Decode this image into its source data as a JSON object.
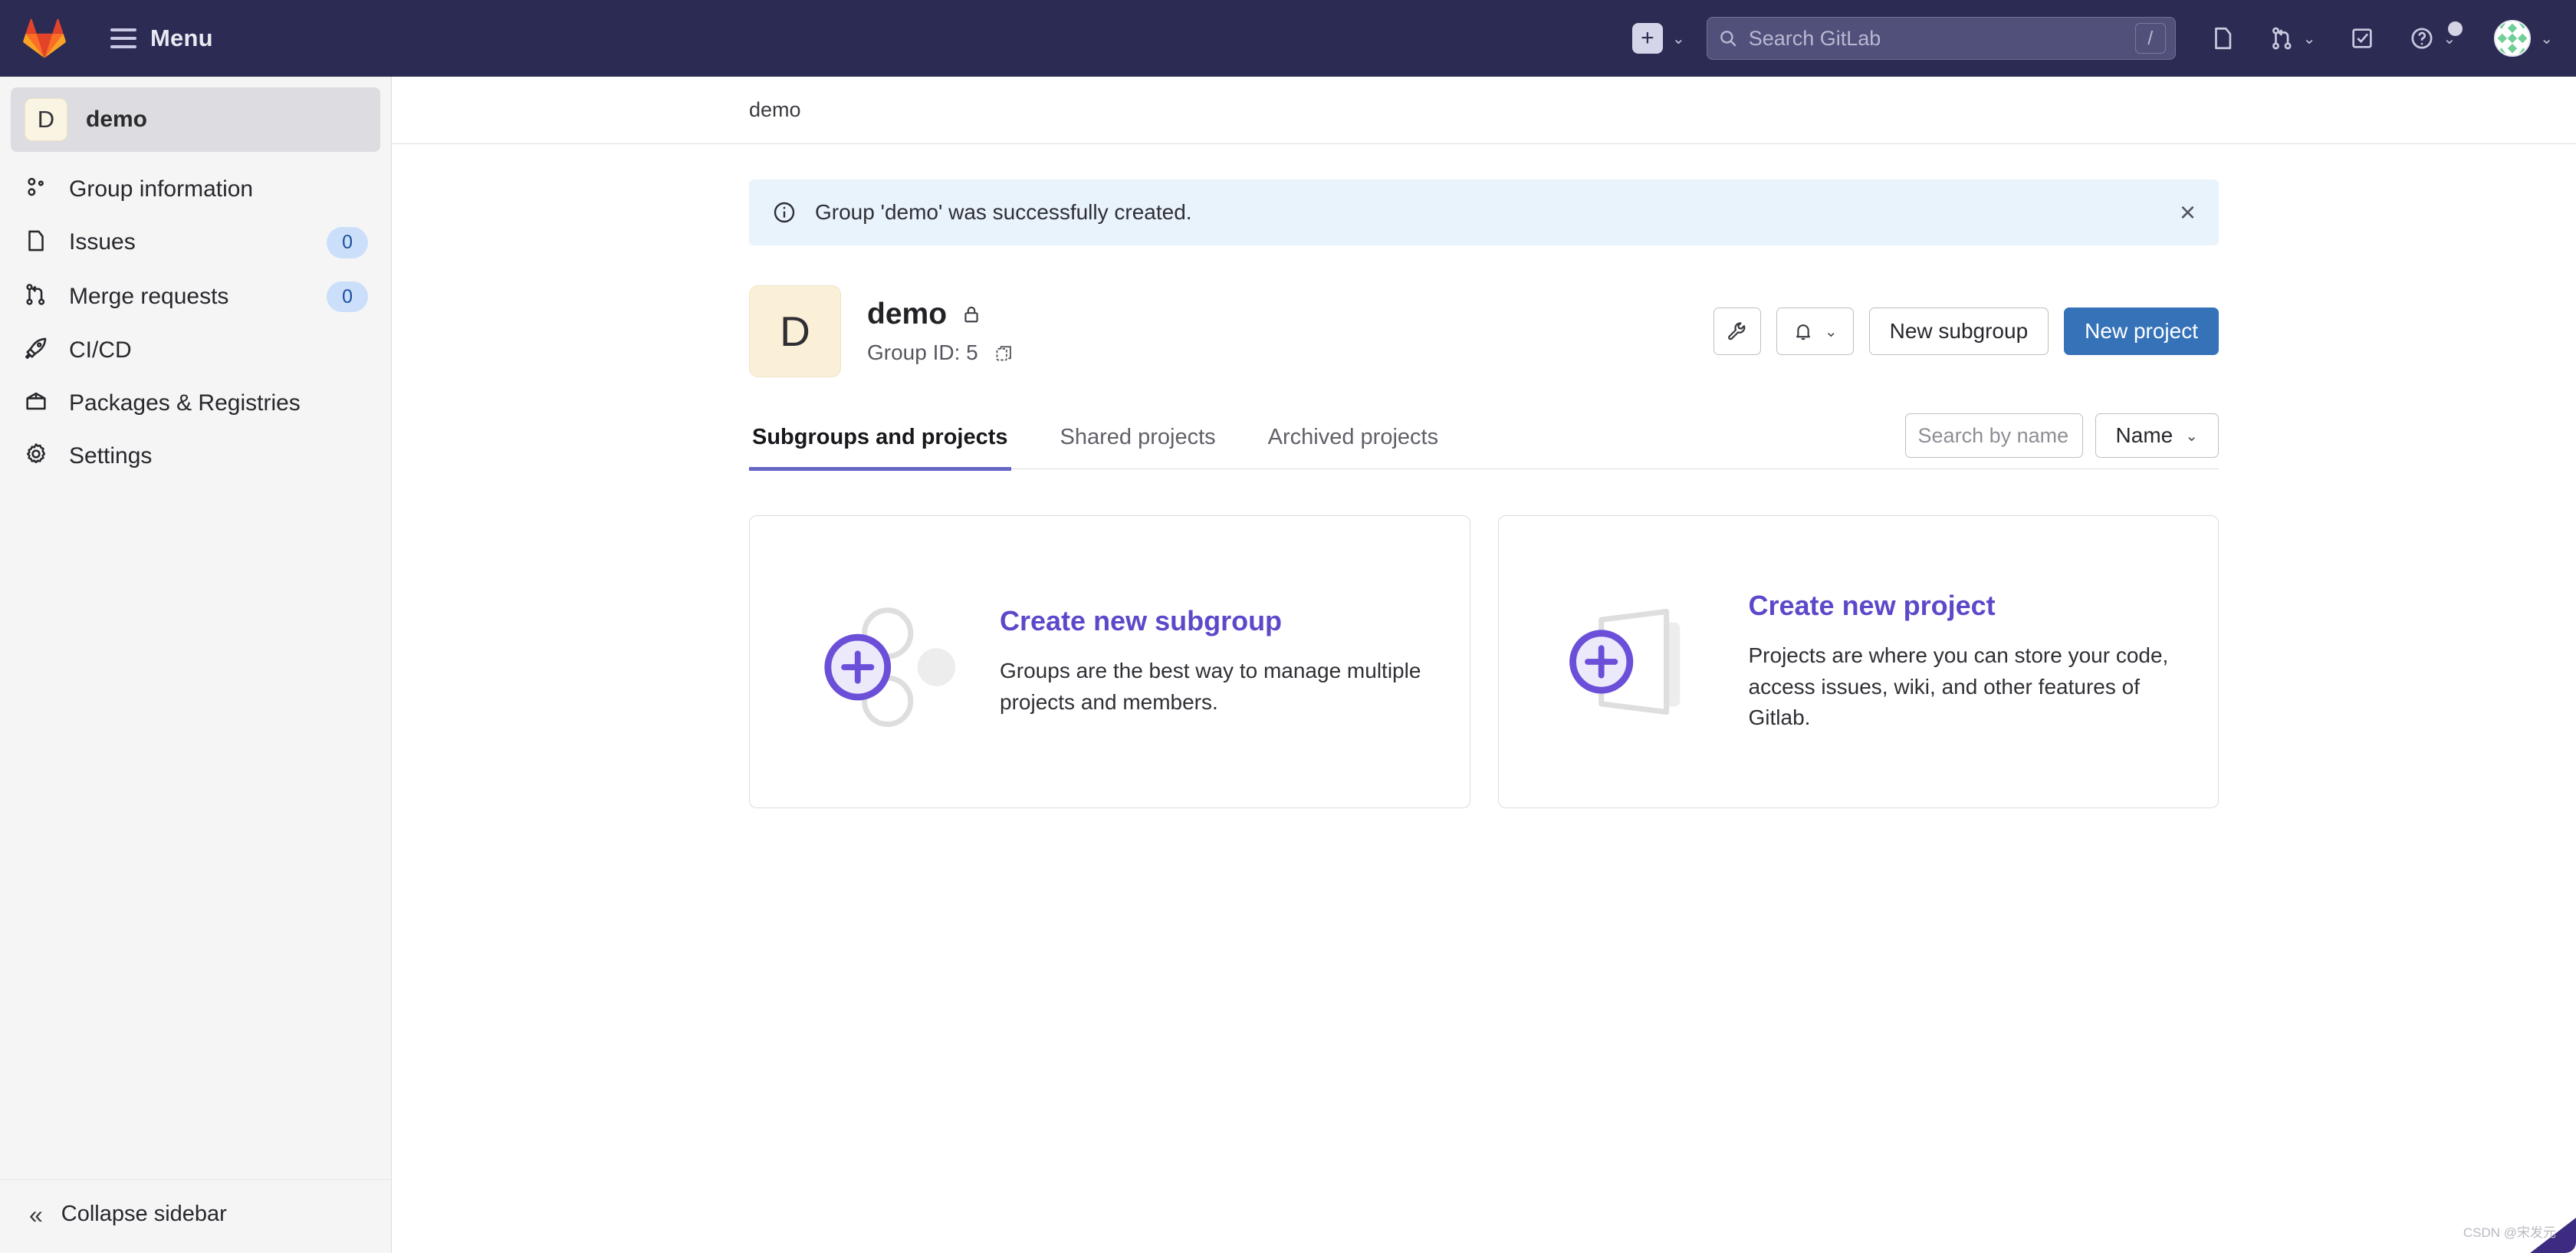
{
  "topnav": {
    "logo_icon": "gitlab-logo-icon",
    "menu_label": "Menu",
    "create_icon": "plus-icon",
    "create_chevron_icon": "chevron-down-icon",
    "search": {
      "icon": "search-icon",
      "placeholder": "Search GitLab",
      "value": "",
      "shortcut": "/"
    },
    "icons": [
      {
        "name": "issues-icon",
        "label": "Issues"
      },
      {
        "name": "merge-requests-icon",
        "label": "Merge requests"
      },
      {
        "name": "todos-icon",
        "label": "To-Do List"
      },
      {
        "name": "help-icon",
        "label": "Help"
      }
    ],
    "avatar_icon": "user-avatar",
    "avatar_chevron_icon": "chevron-down-icon",
    "bg_color": "#2b2b54"
  },
  "sidebar": {
    "group": {
      "initial": "D",
      "name": "demo"
    },
    "items": [
      {
        "label": "Group information",
        "icon": "group-information-icon",
        "badge": null
      },
      {
        "label": "Issues",
        "icon": "issues-icon",
        "badge": "0"
      },
      {
        "label": "Merge requests",
        "icon": "merge-requests-icon",
        "badge": "0"
      },
      {
        "label": "CI/CD",
        "icon": "rocket-icon",
        "badge": null
      },
      {
        "label": "Packages & Registries",
        "icon": "package-icon",
        "badge": null
      },
      {
        "label": "Settings",
        "icon": "gear-icon",
        "badge": null
      }
    ],
    "collapse": {
      "label": "Collapse sidebar",
      "icon": "chevron-double-left-icon"
    }
  },
  "breadcrumb": {
    "items": [
      "demo"
    ]
  },
  "alert": {
    "icon": "information-circle-icon",
    "message": "Group 'demo' was successfully created.",
    "close_icon": "close-icon",
    "bg_color": "#e9f3fc"
  },
  "group_header": {
    "initial": "D",
    "name": "demo",
    "visibility_icon": "lock-icon",
    "group_id_label": "Group ID: 5",
    "copy_icon": "copy-to-clipboard-icon",
    "actions": {
      "settings_icon": "wrench-icon",
      "notifications_icon": "bell-icon",
      "notifications_chevron_icon": "chevron-down-icon",
      "new_subgroup_label": "New subgroup",
      "new_project_label": "New project",
      "primary_color": "#3572b8"
    }
  },
  "tabs": {
    "items": [
      {
        "label": "Subgroups and projects",
        "active": true
      },
      {
        "label": "Shared projects",
        "active": false
      },
      {
        "label": "Archived projects",
        "active": false
      }
    ],
    "active_underline_color": "#6666c4",
    "search": {
      "placeholder": "Search by name",
      "value": ""
    },
    "sort": {
      "label": "Name",
      "chevron_icon": "chevron-down-icon"
    }
  },
  "cards": [
    {
      "illustration": "subgroup-circles-illustration",
      "title": "Create new subgroup",
      "description": "Groups are the best way to manage multiple projects and members.",
      "title_color": "#5b49c9"
    },
    {
      "illustration": "project-folder-illustration",
      "title": "Create new project",
      "description": "Projects are where you can store your code, access issues, wiki, and other features of Gitlab.",
      "title_color": "#5b49c9"
    }
  ],
  "watermark": {
    "text": "CSDN @宋发元"
  }
}
